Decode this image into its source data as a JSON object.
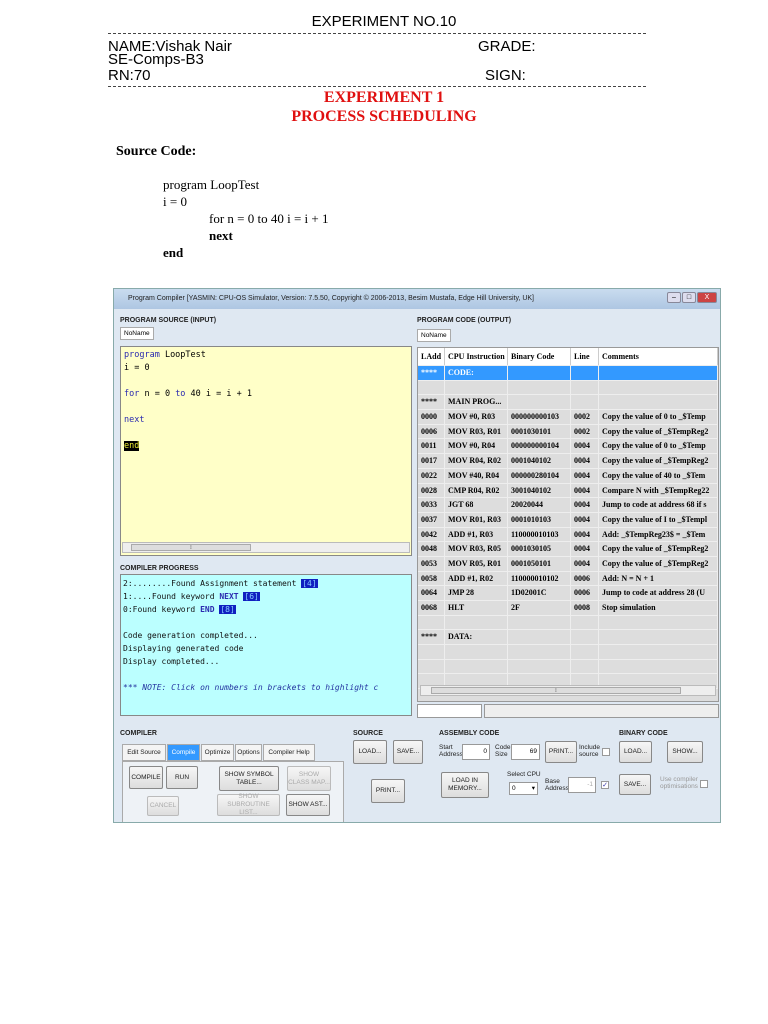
{
  "doc": {
    "header_title": "EXPERIMENT NO.10",
    "name": "NAME:Vishak Nair",
    "class": "SE-Comps-B3",
    "roll": "RN:70",
    "grade": "GRADE:",
    "sign": "SIGN:",
    "exp_title": "EXPERIMENT 1",
    "exp_subtitle": "PROCESS SCHEDULING",
    "source_heading": "Source Code:",
    "source_lines": [
      "program LoopTest",
      "i = 0",
      "for n = 0 to 40 i = i + 1",
      "next",
      "end"
    ]
  },
  "window": {
    "title": "Program Compiler   [YASMIN: CPU-OS Simulator,  Version: 7.5.50,  Copyright © 2006-2013, Besim Mustafa, Edge Hill University, UK]",
    "minimize": "–",
    "maximize": "□",
    "close": "X",
    "source_panel": {
      "label": "PROGRAM SOURCE (INPUT)",
      "tab": "NoName",
      "lines": [
        {
          "kw": "program",
          "rest": " LoopTest"
        },
        {
          "kw": "",
          "rest": " i = 0"
        },
        {
          "kw": "",
          "rest": ""
        },
        {
          "kw": "for",
          "rest": " n = 0 ",
          "kw2": "to",
          "rest2": " 40 i = i + 1"
        },
        {
          "kw": "",
          "rest": ""
        },
        {
          "kw": "next",
          "rest": ""
        },
        {
          "kw": "",
          "rest": ""
        },
        {
          "kw": "end",
          "rest": ""
        }
      ]
    },
    "progress_panel": {
      "label": "COMPILER PROGRESS",
      "lines": [
        {
          "text": " 2:........Found Assignment statement ",
          "ref": "[4]"
        },
        {
          "text": " 1:....Found keyword ",
          "kw": "NEXT",
          "ref": "[6]"
        },
        {
          "text": " 0:Found keyword ",
          "kw": "END",
          "ref": "[8]"
        },
        {
          "text": ""
        },
        {
          "text": "Code generation completed..."
        },
        {
          "text": "Displaying generated code"
        },
        {
          "text": "Display completed..."
        },
        {
          "text": ""
        },
        {
          "note": "*** NOTE: Click on numbers in brackets to highlight c"
        }
      ]
    },
    "output_panel": {
      "label": "PROGRAM CODE (OUTPUT)",
      "tab": "NoName",
      "columns": [
        "LAdd",
        "CPU Instruction",
        "Binary Code",
        "Line",
        "Comments"
      ],
      "rows": [
        [
          "****",
          "CODE:",
          "",
          "",
          ""
        ],
        [
          "",
          "",
          "",
          "",
          ""
        ],
        [
          "****",
          "MAIN PROG...",
          "",
          "",
          ""
        ],
        [
          "0000",
          "MOV #0, R03",
          "000000000103",
          "0002",
          "Copy the value of  0 to _$Temp"
        ],
        [
          "0006",
          "MOV R03, R01",
          "0001030101",
          "0002",
          "Copy the value of _$TempReg2"
        ],
        [
          "0011",
          "MOV #0, R04",
          "000000000104",
          "0004",
          "Copy the value of  0 to _$Temp"
        ],
        [
          "0017",
          "MOV R04, R02",
          "0001040102",
          "0004",
          "Copy the value of _$TempReg2"
        ],
        [
          "0022",
          "MOV #40, R04",
          "000000280104",
          "0004",
          "Copy the value of  40 to _$Tem"
        ],
        [
          "0028",
          "CMP R04, R02",
          "3001040102",
          "0004",
          "Compare N with _$TempReg22"
        ],
        [
          "0033",
          "JGT 68",
          "20020044",
          "0004",
          "Jump to code at address 68 if s"
        ],
        [
          "0037",
          "MOV R01, R03",
          "0001010103",
          "0004",
          "Copy the value of I to _$Templ"
        ],
        [
          "0042",
          "ADD #1, R03",
          "110000010103",
          "0004",
          "Add: _$TempReg23$ = _$Tem"
        ],
        [
          "0048",
          "MOV R03, R05",
          "0001030105",
          "0004",
          "Copy the value of _$TempReg2"
        ],
        [
          "0053",
          "MOV R05, R01",
          "0001050101",
          "0004",
          "Copy the value of _$TempReg2"
        ],
        [
          "0058",
          "ADD #1, R02",
          "110000010102",
          "0006",
          "Add: N = N + 1"
        ],
        [
          "0064",
          "JMP 28",
          "1D02001C",
          "0006",
          "Jump to code at address  28 (U"
        ],
        [
          "0068",
          "HLT",
          "2F",
          "0008",
          "Stop simulation"
        ],
        [
          "",
          "",
          "",
          "",
          ""
        ],
        [
          "****",
          "DATA:",
          "",
          "",
          ""
        ],
        [
          "",
          "",
          "",
          "",
          ""
        ],
        [
          "",
          "",
          "",
          "",
          ""
        ],
        [
          "",
          "",
          "",
          "",
          ""
        ]
      ]
    },
    "compiler": {
      "label": "COMPILER",
      "tabs": [
        "Edit Source",
        "Compile",
        "Optimize",
        "Options",
        "Compiler Help"
      ],
      "compile": "COMPILE",
      "run": "RUN",
      "symbol_table": "SHOW SYMBOL TABLE...",
      "class_map": "SHOW CLASS MAP...",
      "cancel": "CANCEL",
      "subroutine": "SHOW SUBROUTINE LIST...",
      "ast": "SHOW AST..."
    },
    "source": {
      "label": "SOURCE",
      "load": "LOAD...",
      "save": "SAVE...",
      "print": "PRINT..."
    },
    "assembly": {
      "label": "ASSEMBLY CODE",
      "start_label": "Start Address",
      "start_value": "0",
      "size_label": "Code Size",
      "size_value": "69",
      "print": "PRINT...",
      "include_label": "Include source",
      "load_memory": "LOAD IN MEMORY...",
      "cpu_label": "Select CPU",
      "cpu_value": "0",
      "base_label": "Base Address",
      "base_value": "-1"
    },
    "binary": {
      "label": "BINARY CODE",
      "load": "LOAD...",
      "show": "SHOW...",
      "save": "SAVE...",
      "optim_label": "Use compiler optimisations"
    }
  }
}
